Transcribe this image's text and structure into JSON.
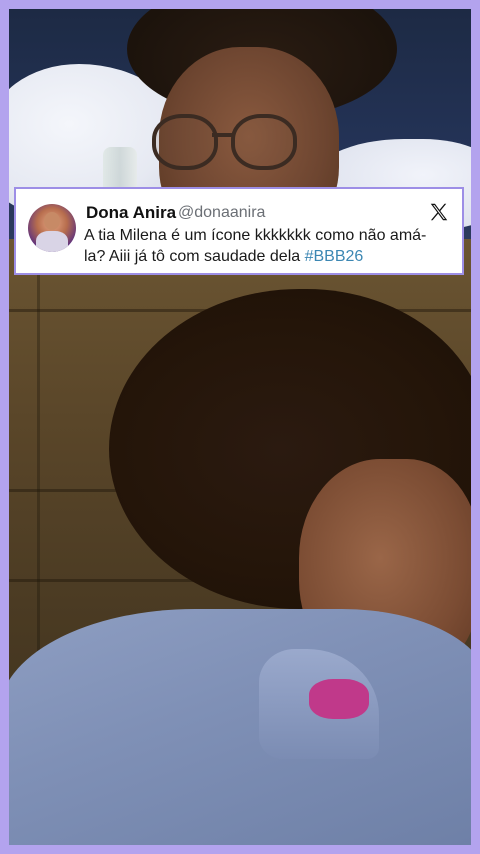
{
  "tweet": {
    "display_name": "Dona Anira",
    "handle": "@donaanira",
    "text_line1": "A tia Milena é um ícone kkkkkkk como não amá-",
    "text_line2": "la? Aiii já tô com saudade dela ",
    "hashtag": "#BBB26",
    "platform_icon": "x-logo-icon",
    "hashtag_color": "#3c87b3"
  },
  "frame": {
    "border_color": "#b3a3ee"
  }
}
